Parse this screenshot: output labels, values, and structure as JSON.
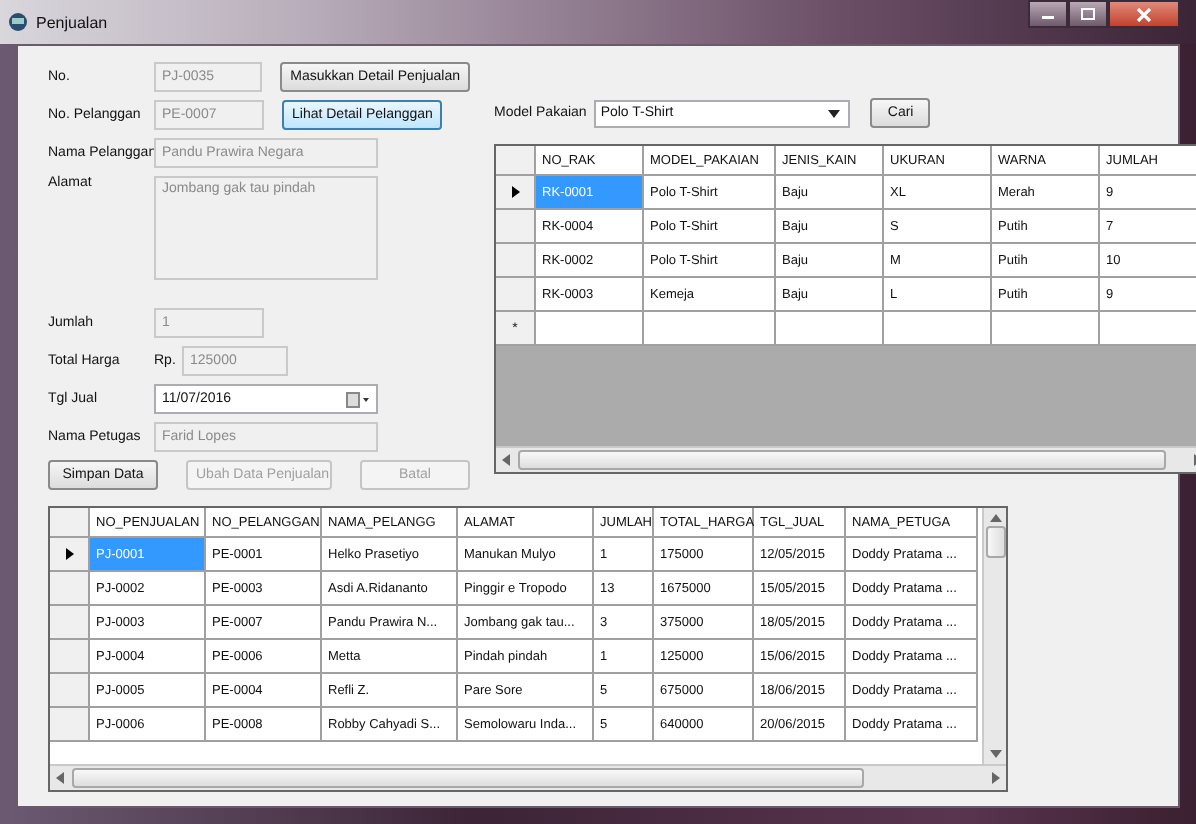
{
  "window": {
    "title": "Penjualan"
  },
  "form": {
    "fields": [
      {
        "kind": "text",
        "label": "No.",
        "value": "PJ-0035",
        "disabled": true
      },
      {
        "kind": "text",
        "label": "No. Pelanggan",
        "value": "PE-0007",
        "disabled": true
      },
      {
        "kind": "wide",
        "label": "Nama Pelanggan",
        "value": "Pandu Prawira Negara",
        "disabled": true
      },
      {
        "kind": "textarea",
        "label": "Alamat",
        "value": "Jombang gak tau pindah",
        "disabled": true
      },
      {
        "kind": "text",
        "label": "Jumlah",
        "value": "1",
        "disabled": true
      },
      {
        "kind": "currency",
        "label": "Total Harga",
        "prefix": "Rp.",
        "value": "125000",
        "disabled": true
      },
      {
        "kind": "date",
        "label": "Tgl Jual",
        "value": "11/07/2016",
        "disabled": false
      },
      {
        "kind": "wide",
        "label": "Nama Petugas",
        "value": "Farid Lopes",
        "disabled": true
      }
    ],
    "side_buttons": [
      {
        "label": "Masukkan Detail Penjualan",
        "focused": false
      },
      {
        "label": "Lihat Detail Pelanggan",
        "focused": true
      }
    ],
    "actions": [
      {
        "label": "Simpan Data",
        "disabled": false
      },
      {
        "label": "Ubah Data Penjualan",
        "disabled": true
      },
      {
        "label": "Batal",
        "disabled": true
      }
    ]
  },
  "search": {
    "label": "Model Pakaian",
    "value": "Polo T-Shirt",
    "button": "Cari"
  },
  "rak_table": {
    "columns": [
      "NO_RAK",
      "MODEL_PAKAIAN",
      "JENIS_KAIN",
      "UKURAN",
      "WARNA",
      "JUMLAH"
    ],
    "rows": [
      {
        "cells": [
          "RK-0001",
          "Polo T-Shirt",
          "Baju",
          "XL",
          "Merah",
          "9"
        ],
        "selected": true
      },
      {
        "cells": [
          "RK-0004",
          "Polo T-Shirt",
          "Baju",
          "S",
          "Putih",
          "7"
        ],
        "selected": false
      },
      {
        "cells": [
          "RK-0002",
          "Polo T-Shirt",
          "Baju",
          "M",
          "Putih",
          "10"
        ],
        "selected": false
      },
      {
        "cells": [
          "RK-0003",
          "Kemeja",
          "Baju",
          "L",
          "Putih",
          "9"
        ],
        "selected": false
      }
    ],
    "new_row_marker": "*"
  },
  "sales_table": {
    "columns": [
      "NO_PENJUALAN",
      "NO_PELANGGAN",
      "NAMA_PELANGG",
      "ALAMAT",
      "JUMLAH",
      "TOTAL_HARGA",
      "TGL_JUAL",
      "NAMA_PETUGA"
    ],
    "rows": [
      {
        "cells": [
          "PJ-0001",
          "PE-0001",
          "Helko Prasetiyo",
          "Manukan Mulyo",
          "1",
          "175000",
          "12/05/2015",
          "Doddy Pratama ..."
        ],
        "selected": true
      },
      {
        "cells": [
          "PJ-0002",
          "PE-0003",
          "Asdi A.Ridananto",
          "Pinggir e Tropodo",
          "13",
          "1675000",
          "15/05/2015",
          "Doddy Pratama ..."
        ],
        "selected": false
      },
      {
        "cells": [
          "PJ-0003",
          "PE-0007",
          "Pandu Prawira N...",
          "Jombang gak tau...",
          "3",
          "375000",
          "18/05/2015",
          "Doddy Pratama ..."
        ],
        "selected": false
      },
      {
        "cells": [
          "PJ-0004",
          "PE-0006",
          "Metta",
          "Pindah pindah",
          "1",
          "125000",
          "15/06/2015",
          "Doddy Pratama ..."
        ],
        "selected": false
      },
      {
        "cells": [
          "PJ-0005",
          "PE-0004",
          "Refli Z.",
          "Pare Sore",
          "5",
          "675000",
          "18/06/2015",
          "Doddy Pratama ..."
        ],
        "selected": false
      },
      {
        "cells": [
          "PJ-0006",
          "PE-0008",
          "Robby Cahyadi S...",
          "Semolowaru Inda...",
          "5",
          "640000",
          "20/06/2015",
          "Doddy Pratama ..."
        ],
        "selected": false
      }
    ]
  }
}
